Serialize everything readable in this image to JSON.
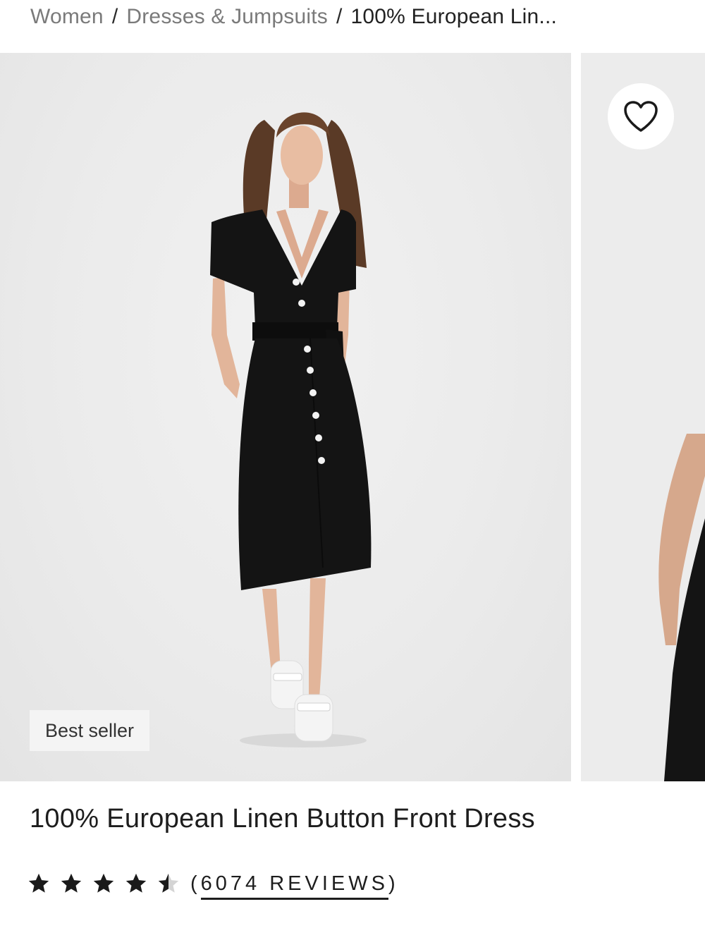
{
  "breadcrumb": {
    "items": [
      "Women",
      "Dresses & Jumpsuits"
    ],
    "separator": "/",
    "current": "100% European Lin..."
  },
  "gallery": {
    "badge": "Best seller",
    "wishlist_icon": "heart-outline-icon"
  },
  "product": {
    "title": "100% European Linen Button Front Dress"
  },
  "rating": {
    "stars": 4.5,
    "open_paren": "(",
    "reviews_label": "6074 REVIEWS",
    "close_paren": ")"
  },
  "colors": {
    "text": "#1d1d1d",
    "muted": "#7a7a7a",
    "photo_bg": "#ebebeb",
    "dress": "#141414"
  }
}
